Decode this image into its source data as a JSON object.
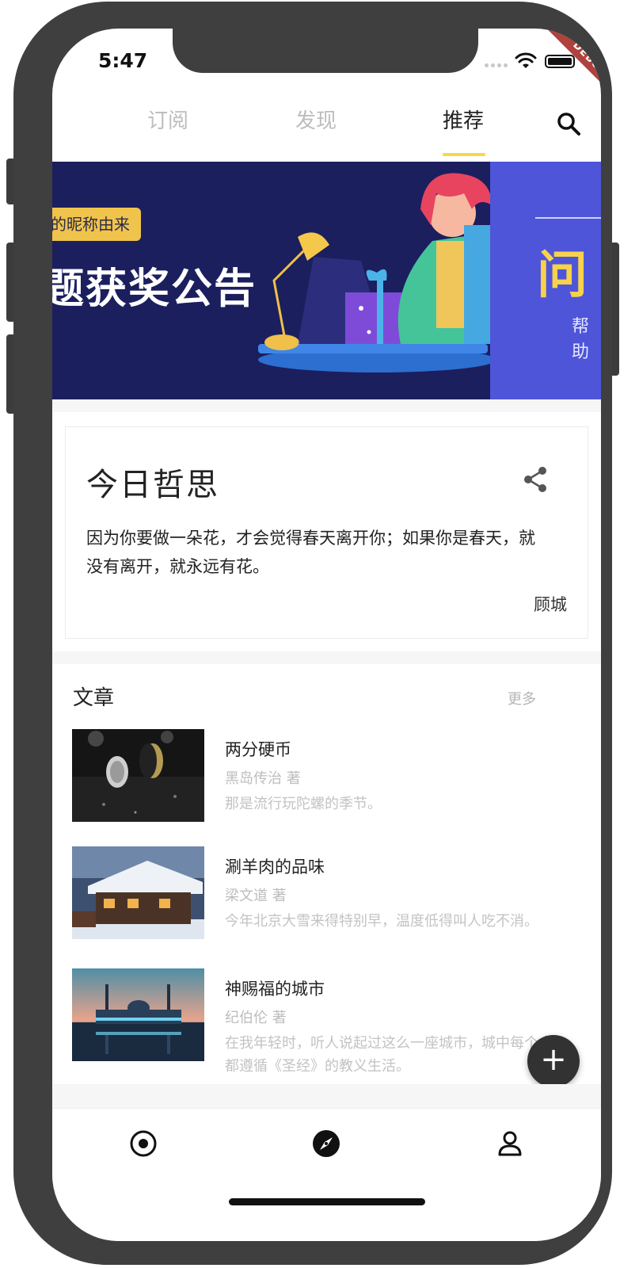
{
  "status_bar": {
    "time": "5:47",
    "debug_label": "DEBUG"
  },
  "tabs": [
    {
      "label": "订阅",
      "active": false
    },
    {
      "label": "发现",
      "active": false
    },
    {
      "label": "推荐",
      "active": true
    }
  ],
  "banner": {
    "tag": "的昵称由来",
    "title": "题获奖公告",
    "right_big": "问",
    "right_small": "帮助"
  },
  "quote": {
    "title": "今日哲思",
    "text": "因为你要做一朵花，才会觉得春天离开你；如果你是春天，就没有离开，就永远有花。",
    "author": "顾城"
  },
  "articles": {
    "title": "文章",
    "more": "更多",
    "items": [
      {
        "title": "两分硬币",
        "author": "黑岛传治 著",
        "excerpt": "那是流行玩陀螺的季节。"
      },
      {
        "title": "涮羊肉的品味",
        "author": "梁文道 著",
        "excerpt": "今年北京大雪来得特别早，温度低得叫人吃不消。"
      },
      {
        "title": "神赐福的城市",
        "author": "纪伯伦 著",
        "excerpt": "在我年轻时，听人说起过这么一座城市，城中每个人都遵循《圣经》的教义生活。"
      }
    ]
  },
  "fab": {
    "label": "+"
  },
  "colors": {
    "accent": "#f5d94a",
    "frame": "#3f3f3f",
    "banner_bg": "#1b1f5e",
    "fab_bg": "#323232"
  },
  "icons": [
    "search-icon",
    "share-icon",
    "home-target-icon",
    "compass-icon",
    "person-icon",
    "wifi-icon",
    "battery-icon"
  ]
}
